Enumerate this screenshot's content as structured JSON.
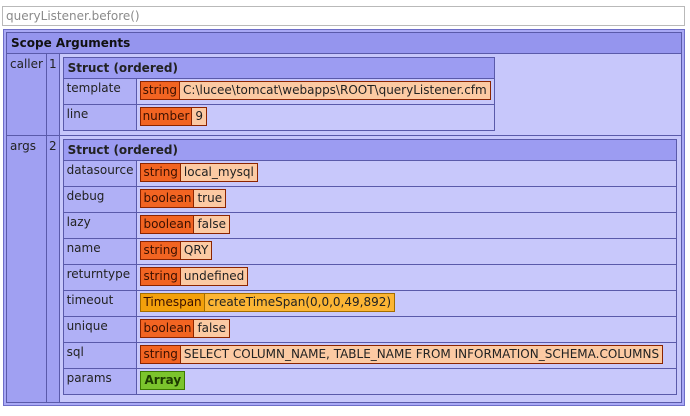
{
  "title": "queryListener.before()",
  "scope_title": "Scope Arguments",
  "caller": {
    "name": "caller",
    "index": "1",
    "struct_title": "Struct (ordered)",
    "rows": [
      {
        "key": "template",
        "type": "string",
        "value": "C:\\lucee\\tomcat\\webapps\\ROOT\\queryListener.cfm"
      },
      {
        "key": "line",
        "type": "number",
        "value": "9"
      }
    ]
  },
  "args": {
    "name": "args",
    "index": "2",
    "struct_title": "Struct (ordered)",
    "rows": [
      {
        "key": "datasource",
        "type": "string",
        "value": "local_mysql"
      },
      {
        "key": "debug",
        "type": "boolean",
        "value": "true"
      },
      {
        "key": "lazy",
        "type": "boolean",
        "value": "false"
      },
      {
        "key": "name",
        "type": "string",
        "value": "QRY"
      },
      {
        "key": "returntype",
        "type": "string",
        "value": "undefined"
      },
      {
        "key": "timeout",
        "type": "Timespan",
        "value": "createTimeSpan(0,0,0,49,892)"
      },
      {
        "key": "unique",
        "type": "boolean",
        "value": "false"
      },
      {
        "key": "sql",
        "type": "string",
        "value": "SELECT COLUMN_NAME, TABLE_NAME FROM INFORMATION_SCHEMA.COLUMNS"
      },
      {
        "key": "params",
        "type": "",
        "value": "Array"
      }
    ]
  },
  "colors": {
    "scope_bg": "#a9a9f5",
    "header_bg": "#9595ee",
    "string_type": "#f26422",
    "string_value": "#fccaa3",
    "timespan_type": "#f3a00b",
    "timespan_value": "#fcb534",
    "array_badge": "#7bc42d"
  }
}
